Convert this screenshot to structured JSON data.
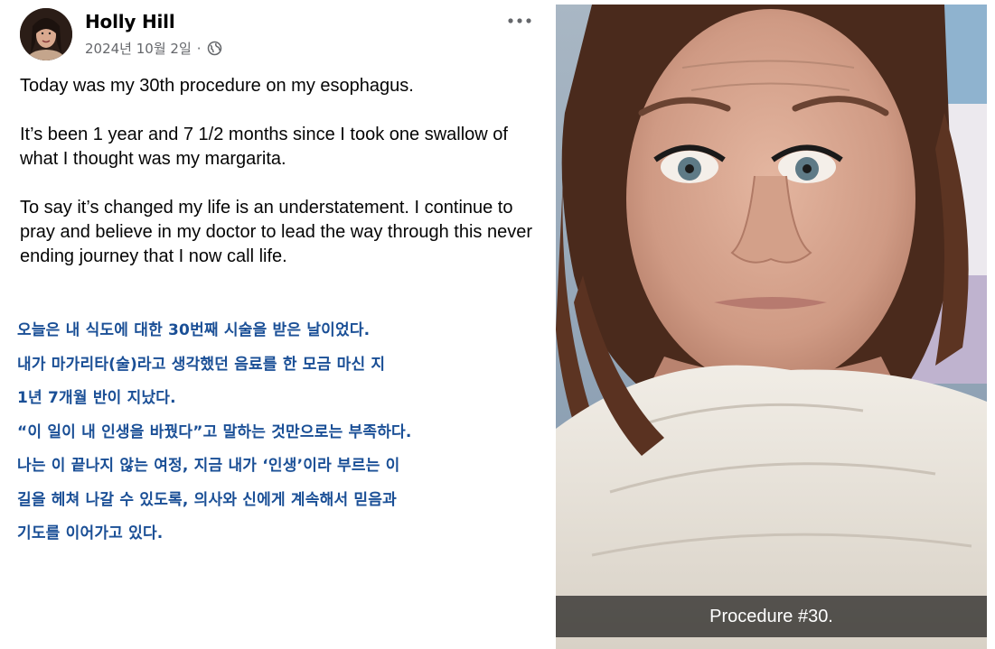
{
  "post": {
    "author": "Holly Hill",
    "date": "2024년 10월 2일",
    "separator": "·",
    "privacy_icon": "globe-icon",
    "more_icon": "more-options-icon",
    "english_paragraphs": [
      "Today was my 30th procedure on my esophagus.",
      "It’s been 1 year and 7 1/2 months since I took one swallow of what I thought was my margarita.",
      "To say it’s changed my life is an understatement. I continue to pray and believe in my doctor to lead the way through this never ending journey that I now call life."
    ],
    "korean_lines": [
      "오늘은 내 식도에 대한 30번째 시술을 받은 날이었다.",
      "내가 마가리타(술)라고 생각했던 음료를 한 모금 마신 지",
      "1년 7개월 반이 지났다.",
      "“이 일이 내 인생을 바꿨다”고 말하는 것만으로는 부족하다.",
      "나는 이 끝나지 않는 여정, 지금 내가 ‘인생’이라 부르는 이",
      "길을 헤쳐 나갈 수 있도록, 의사와 신에게 계속해서 믿음과",
      "기도를 이어가고 있다."
    ]
  },
  "photo": {
    "caption": "Procedure #30."
  },
  "colors": {
    "author_text": "#050505",
    "meta_text": "#65676b",
    "korean_text": "#1a4f96",
    "caption_bg": "#000000"
  }
}
